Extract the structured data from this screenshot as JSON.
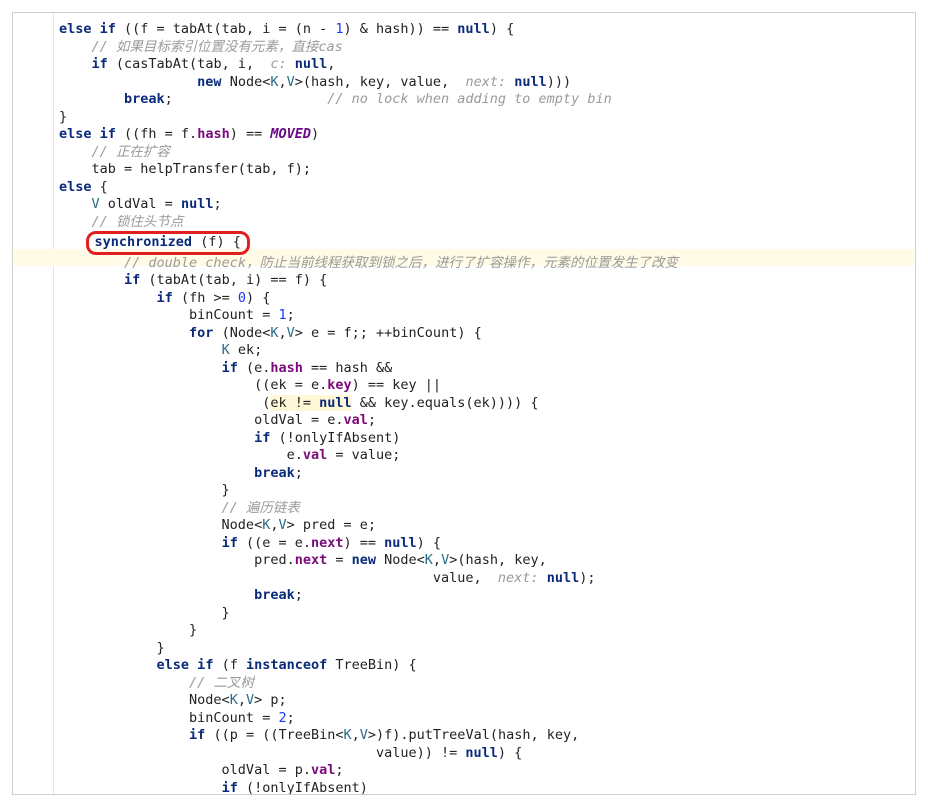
{
  "code": {
    "l01a": "else if",
    "l01b": " ((f = tabAt(tab, i = (n - ",
    "l01c": "1",
    "l01d": ") & hash)) == ",
    "l01e": "null",
    "l01f": ") {",
    "l02": "    // 如果目标索引位置没有元素，直接cas",
    "l03a": "    ",
    "l03b": "if",
    "l03c": " (casTabAt(tab, i, ",
    "l03d": " c: ",
    "l03e": "null",
    "l03f": ",",
    "l04a": "                 ",
    "l04b": "new",
    "l04c": " Node<",
    "l04d": "K",
    "l04e": ",",
    "l04f": "V",
    "l04g": ">(hash, key, value, ",
    "l04h": " next: ",
    "l04i": "null",
    "l04j": ")))",
    "l05a": "        ",
    "l05b": "break",
    "l05c": ";                   ",
    "l05d": "// no lock when adding to empty bin",
    "l06": "}",
    "l07a": "else if",
    "l07b": " ((fh = f.",
    "l07c": "hash",
    "l07d": ") == ",
    "l07e": "MOVED",
    "l07f": ")",
    "l08": "    // 正在扩容",
    "l09": "    tab = helpTransfer(tab, f);",
    "l10a": "else",
    "l10b": " {",
    "l11a": "    ",
    "l11b": "V",
    "l11c": " oldVal = ",
    "l11d": "null",
    "l11e": ";",
    "l12": "    // 锁住头节点",
    "l13a": "synchronized",
    "l13b": " (f) {",
    "l14a": "        ",
    "l14b": "// double check，",
    "l14c": "防止当前线程获取到锁之后，",
    "l14d": "进行了扩容操作，元素的位置发生了改变",
    "l15a": "        ",
    "l15b": "if",
    "l15c": " (tabAt(tab, i) == f) {",
    "l16a": "            ",
    "l16b": "if",
    "l16c": " (fh >= ",
    "l16d": "0",
    "l16e": ") {",
    "l17a": "                binCount = ",
    "l17b": "1",
    "l17c": ";",
    "l18a": "                ",
    "l18b": "for",
    "l18c": " (Node<",
    "l18d": "K",
    "l18e": ",",
    "l18f": "V",
    "l18g": "> e = f;; ++binCount) {",
    "l19a": "                    ",
    "l19b": "K",
    "l19c": " ek;",
    "l20a": "                    ",
    "l20b": "if",
    "l20c": " (e.",
    "l20d": "hash",
    "l20e": " == hash &&",
    "l21a": "                        ((ek = e.",
    "l21b": "key",
    "l21c": ") == key ||",
    "l22a": "                         (",
    "l22b": "ek != ",
    "l22c": "null",
    "l22d": " && key.equals(ek)))) {",
    "l23a": "                        oldVal = e.",
    "l23b": "val",
    "l23c": ";",
    "l24a": "                        ",
    "l24b": "if",
    "l24c": " (!onlyIfAbsent)",
    "l25a": "                            e.",
    "l25b": "val",
    "l25c": " = value;",
    "l26a": "                        ",
    "l26b": "break",
    "l26c": ";",
    "l27": "                    }",
    "l28": "                    // 遍历链表",
    "l29a": "                    Node<",
    "l29b": "K",
    "l29c": ",",
    "l29d": "V",
    "l29e": "> pred = e;",
    "l30a": "                    ",
    "l30b": "if",
    "l30c": " ((e = e.",
    "l30d": "next",
    "l30e": ") == ",
    "l30f": "null",
    "l30g": ") {",
    "l31a": "                        pred.",
    "l31b": "next",
    "l31c": " = ",
    "l31d": "new",
    "l31e": " Node<",
    "l31f": "K",
    "l31g": ",",
    "l31h": "V",
    "l31i": ">(hash, key,",
    "l32a": "                                              value, ",
    "l32b": " next: ",
    "l32c": "null",
    "l32d": ");",
    "l33a": "                        ",
    "l33b": "break",
    "l33c": ";",
    "l34": "                    }",
    "l35": "                }",
    "l36": "            }",
    "l37a": "            ",
    "l37b": "else if",
    "l37c": " (f ",
    "l37d": "instanceof",
    "l37e": " TreeBin) {",
    "l38": "                // 二叉树",
    "l39a": "                Node<",
    "l39b": "K",
    "l39c": ",",
    "l39d": "V",
    "l39e": "> p;",
    "l40a": "                binCount = ",
    "l40b": "2",
    "l40c": ";",
    "l41a": "                ",
    "l41b": "if",
    "l41c": " ((p = ((TreeBin<",
    "l41d": "K",
    "l41e": ",",
    "l41f": "V",
    "l41g": ">)f).putTreeVal(hash, key,",
    "l42a": "                                       value)) != ",
    "l42b": "null",
    "l42c": ") {",
    "l43a": "                    oldVal = p.",
    "l43b": "val",
    "l43c": ";",
    "l44a": "                    ",
    "l44b": "if",
    "l44c": " (!onlyIfAbsent)"
  }
}
